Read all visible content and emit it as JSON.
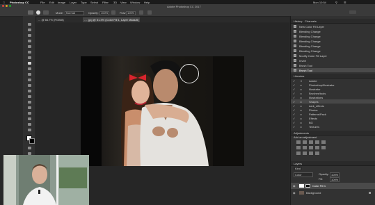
{
  "menubar": {
    "apple_icon": "apple-icon",
    "items": [
      "Photoshop CC",
      "File",
      "Edit",
      "Image",
      "Layer",
      "Type",
      "Select",
      "Filter",
      "3D",
      "View",
      "Window",
      "Help"
    ],
    "status_right": "Mon 10:54"
  },
  "window": {
    "title": "Adobe Photoshop CC 2017"
  },
  "options_bar": {
    "mode_label": "Mode:",
    "mode_value": "Normal",
    "opacity_label": "Opacity:",
    "opacity_value": "100%",
    "flow_label": "Flow:",
    "flow_value": "100%"
  },
  "document_tabs": [
    "... @ 66.7% (RGB/8)",
    "… .jpg @ 51.3% (Color Fill 1, Layer Mask/8)"
  ],
  "history_panel": {
    "tabs": [
      "History",
      "Channels"
    ],
    "items": [
      "New Color Fill Layer",
      "Blending Change",
      "Blending Change",
      "Blending Change",
      "Blending Change",
      "Blending Change",
      "Modify Color Fill Layer",
      "Invert",
      "Brush Tool",
      "Brush Tool"
    ]
  },
  "layer_comps_panel": {
    "title": "Libraries",
    "items": [
      "Adobe",
      "Photoshop/Illustrator",
      "Illustrator",
      "Brushes/tools",
      "Illustrations",
      "Shapes",
      "dark_effects",
      "Photos",
      "Patterns/Pack",
      "Effects",
      "BG",
      "Textures"
    ]
  },
  "adjustments_panel": {
    "title": "Adjustments",
    "subtitle": "Add an adjustment"
  },
  "layers_panel": {
    "title": "Layers",
    "kind_label": "Kind",
    "blend_mode": "Color",
    "opacity_label": "Opacity:",
    "opacity_value": "100%",
    "fill_label": "Fill:",
    "fill_value": "100%",
    "layers": [
      {
        "name": "Color Fill 1"
      },
      {
        "name": "Background"
      }
    ]
  }
}
